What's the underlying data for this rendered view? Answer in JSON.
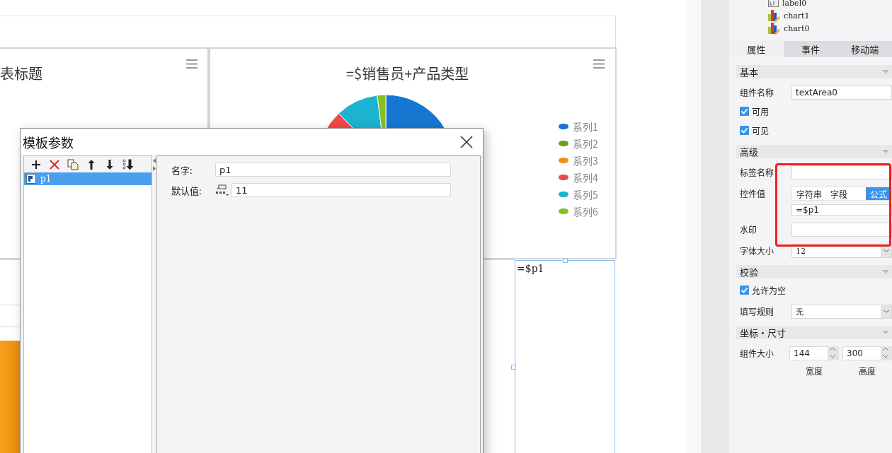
{
  "canvas": {
    "charts": [
      {
        "title": "表标题"
      },
      {
        "title": "=$销售员+产品类型",
        "legend": [
          {
            "label": "系列1",
            "color": "#1a73d0"
          },
          {
            "label": "系列2",
            "color": "#6aa21f"
          },
          {
            "label": "系列3",
            "color": "#f39012"
          },
          {
            "label": "系列4",
            "color": "#f04848"
          },
          {
            "label": "系列5",
            "color": "#1bb3d0"
          },
          {
            "label": "系列6",
            "color": "#86c021"
          }
        ]
      }
    ],
    "text_area": {
      "value": "=$p1",
      "selected": true
    }
  },
  "dialog": {
    "title": "模板参数",
    "parameters": [
      {
        "name": "p1",
        "selected": true
      }
    ],
    "fields": [
      {
        "label": "名字:",
        "value": "p1",
        "kind": "text"
      },
      {
        "label": "默认值:",
        "value": "11",
        "kind": "typed"
      }
    ]
  },
  "panel": {
    "tree": [
      {
        "label": "label0",
        "kind": "label"
      },
      {
        "label": "chart1",
        "kind": "chart"
      },
      {
        "label": "chart0",
        "kind": "chart"
      }
    ],
    "tabs": [
      {
        "label": "属性",
        "selected": true
      },
      {
        "label": "事件",
        "selected": false
      },
      {
        "label": "移动端",
        "selected": false
      }
    ],
    "sections": [
      {
        "title": "基本",
        "rows": [
          {
            "kind": "text",
            "label": "组件名称",
            "value": "textArea0"
          },
          {
            "kind": "checkbox",
            "label": "可用",
            "checked": true
          },
          {
            "kind": "checkbox",
            "label": "可见",
            "checked": true
          }
        ]
      },
      {
        "title": "高级",
        "rows": [
          {
            "kind": "text",
            "label": "标签名称"
          },
          {
            "kind": "segmented",
            "label": "控件值",
            "options": [
              {
                "label": "字符串",
                "selected": false
              },
              {
                "label": "字段",
                "selected": false
              },
              {
                "label": "公式",
                "selected": true
              }
            ],
            "value": "=$p1"
          },
          {
            "kind": "text",
            "label": "水印"
          },
          {
            "kind": "select",
            "label": "字体大小",
            "value": "12"
          }
        ]
      },
      {
        "title": "校验",
        "rows": [
          {
            "kind": "checkbox",
            "label": "允许为空",
            "checked": true
          },
          {
            "kind": "select",
            "label": "填写规则",
            "value": "无"
          }
        ]
      },
      {
        "title": "坐标・尺寸",
        "rows": [
          {
            "kind": "size",
            "label": "组件大小",
            "fields": [
              {
                "value": "144",
                "caption": "宽度"
              },
              {
                "value": "300",
                "caption": "高度"
              }
            ]
          }
        ]
      }
    ]
  }
}
